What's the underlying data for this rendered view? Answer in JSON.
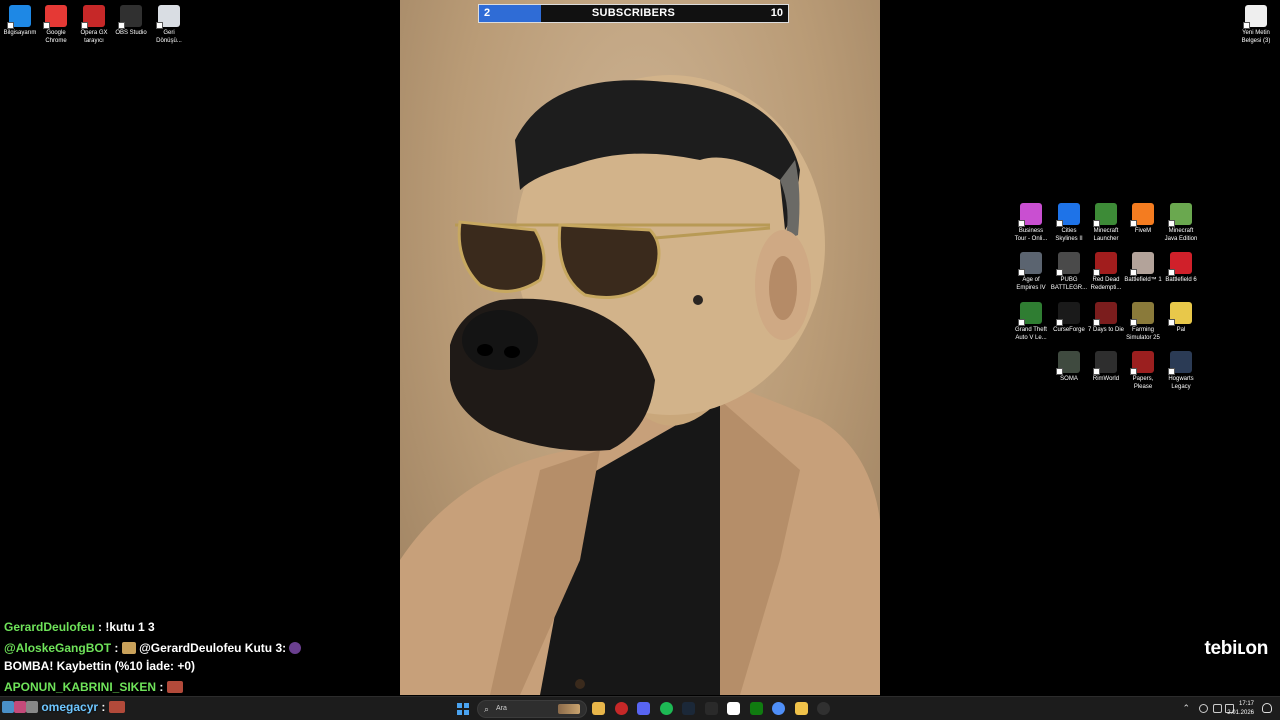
{
  "desktop_left": [
    {
      "label": "Bilgisayarım",
      "icon": "computer-icon",
      "color": "#1e88e5"
    },
    {
      "label": "Google\nChrome",
      "icon": "chrome-icon",
      "color": "#e53935"
    },
    {
      "label": "Opera GX\ntarayıcı",
      "icon": "opera-gx-icon",
      "color": "#c62828"
    },
    {
      "label": "OBS Studio",
      "icon": "obs-icon",
      "color": "#303030"
    },
    {
      "label": "Geri\nDönüşü...",
      "icon": "recycle-bin-icon",
      "color": "#d9dde3"
    }
  ],
  "desktop_right_top": {
    "label": "Yeni Metin\nBelgesi (3)",
    "icon": "text-document-icon",
    "color": "#eeeeee"
  },
  "desktop_grid": [
    {
      "label": "Business\nTour - Onli...",
      "icon": "business-tour-icon",
      "color": "#c94fd1"
    },
    {
      "label": "Cities\nSkylines II",
      "icon": "cities-skylines-icon",
      "color": "#1e73e8"
    },
    {
      "label": "Minecraft\nLauncher",
      "icon": "minecraft-launcher-icon",
      "color": "#3d8b37"
    },
    {
      "label": "FiveM",
      "icon": "fivem-icon",
      "color": "#f47c20"
    },
    {
      "label": "Minecraft\nJava Edition",
      "icon": "minecraft-java-icon",
      "color": "#6aa84f"
    },
    {
      "label": "Age of\nEmpires IV",
      "icon": "age-of-empires-icon",
      "color": "#5b6470"
    },
    {
      "label": "PUBG\nBATTLEGR...",
      "icon": "pubg-icon",
      "color": "#4a4a4a"
    },
    {
      "label": "Red Dead\nRedempti...",
      "icon": "red-dead-icon",
      "color": "#a11d1d"
    },
    {
      "label": "Battlefield™ 1",
      "icon": "battlefield-1-icon",
      "color": "#b3a39a"
    },
    {
      "label": "Battlefield 6",
      "icon": "battlefield-6-icon",
      "color": "#d0202a"
    },
    {
      "label": "Grand Theft\nAuto V Le...",
      "icon": "gta-v-icon",
      "color": "#2f7d32"
    },
    {
      "label": "CurseForge",
      "icon": "curseforge-icon",
      "color": "#1a1a1a"
    },
    {
      "label": "7 Days to Die",
      "icon": "seven-days-icon",
      "color": "#7b1d1d"
    },
    {
      "label": "Farming\nSimulator 25",
      "icon": "farming-sim-icon",
      "color": "#8a7a3a"
    },
    {
      "label": "Pal",
      "icon": "pal-icon",
      "color": "#e8c84a"
    },
    {
      "label": "SOMA",
      "icon": "soma-icon",
      "color": "#3f4a3f"
    },
    {
      "label": "RimWorld",
      "icon": "rimworld-icon",
      "color": "#2e2e2e"
    },
    {
      "label": "Papers,\nPlease",
      "icon": "papers-please-icon",
      "color": "#9b1f1f"
    },
    {
      "label": "Hogwarts\nLegacy",
      "icon": "hogwarts-icon",
      "color": "#2b3b55"
    }
  ],
  "subscriber_bar": {
    "current": "2",
    "label": "SUBSCRIBERS",
    "goal": "10",
    "progress_fraction": 0.2,
    "fill_color": "#2f6cd6"
  },
  "chat": [
    {
      "user": "GerardDeulofeu",
      "sep": " : ",
      "text": "!kutu 1 3"
    },
    {
      "user": "@AloskeGangBOT",
      "sep": " : ",
      "text": " @GerardDeulofeu Kutu 3: "
    },
    {
      "user": "",
      "sep": "",
      "text": "BOMBA! Kaybettin (%10 İade: +0)"
    },
    {
      "user": "APONUN_KABRINI_SIKEN",
      "sep": " : ",
      "text": ""
    },
    {
      "user": "omegacyr",
      "sep": " : ",
      "text": ""
    }
  ],
  "watermark": "tebiʟon",
  "taskbar": {
    "search_placeholder": "Ara",
    "clock_time": "17:17",
    "clock_date": "2.01.2026",
    "apps": [
      {
        "icon": "file-explorer-icon",
        "color": "#e8b64a"
      },
      {
        "icon": "opera-gx-icon",
        "color": "#c62828"
      },
      {
        "icon": "discord-icon",
        "color": "#5865f2"
      },
      {
        "icon": "spotify-icon",
        "color": "#1db954"
      },
      {
        "icon": "steam-icon",
        "color": "#1b2838"
      },
      {
        "icon": "epic-games-icon",
        "color": "#2a2a2a"
      },
      {
        "icon": "capcut-icon",
        "color": "#ffffff"
      },
      {
        "icon": "xbox-icon",
        "color": "#107c10"
      },
      {
        "icon": "copilot-icon",
        "color": "#4f8ff7"
      },
      {
        "icon": "folder-icon",
        "color": "#f0c24a"
      },
      {
        "icon": "obs-icon",
        "color": "#303030"
      }
    ]
  }
}
